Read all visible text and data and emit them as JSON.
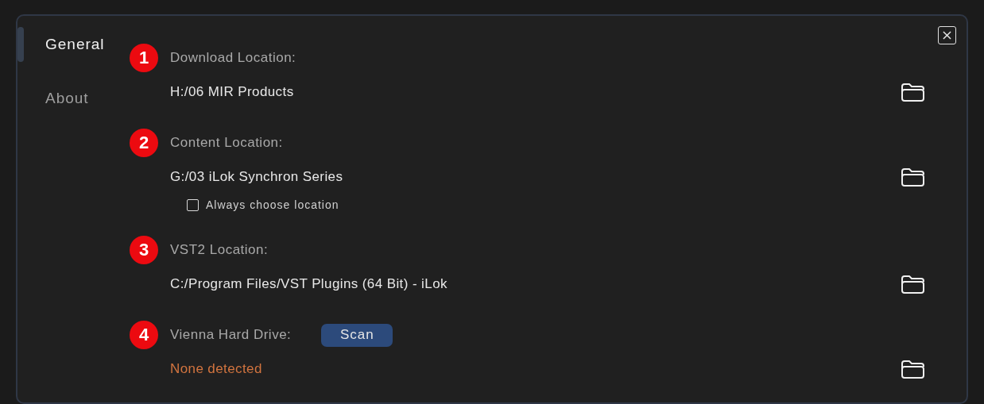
{
  "sidebar": {
    "items": [
      {
        "label": "General",
        "selected": true
      },
      {
        "label": "About",
        "selected": false
      }
    ]
  },
  "sections": [
    {
      "marker": "1",
      "label": "Download Location:",
      "value": "H:/06 MIR Products",
      "kind": "path"
    },
    {
      "marker": "2",
      "label": "Content Location:",
      "value": "G:/03 iLok Synchron Series",
      "kind": "path",
      "option": {
        "label": "Always choose location",
        "checked": false
      }
    },
    {
      "marker": "3",
      "label": "VST2 Location:",
      "value": "C:/Program Files/VST Plugins (64 Bit) - iLok",
      "kind": "path"
    },
    {
      "marker": "4",
      "label": "Vienna Hard Drive:",
      "button": "Scan",
      "value": "None detected",
      "kind": "warning"
    }
  ]
}
